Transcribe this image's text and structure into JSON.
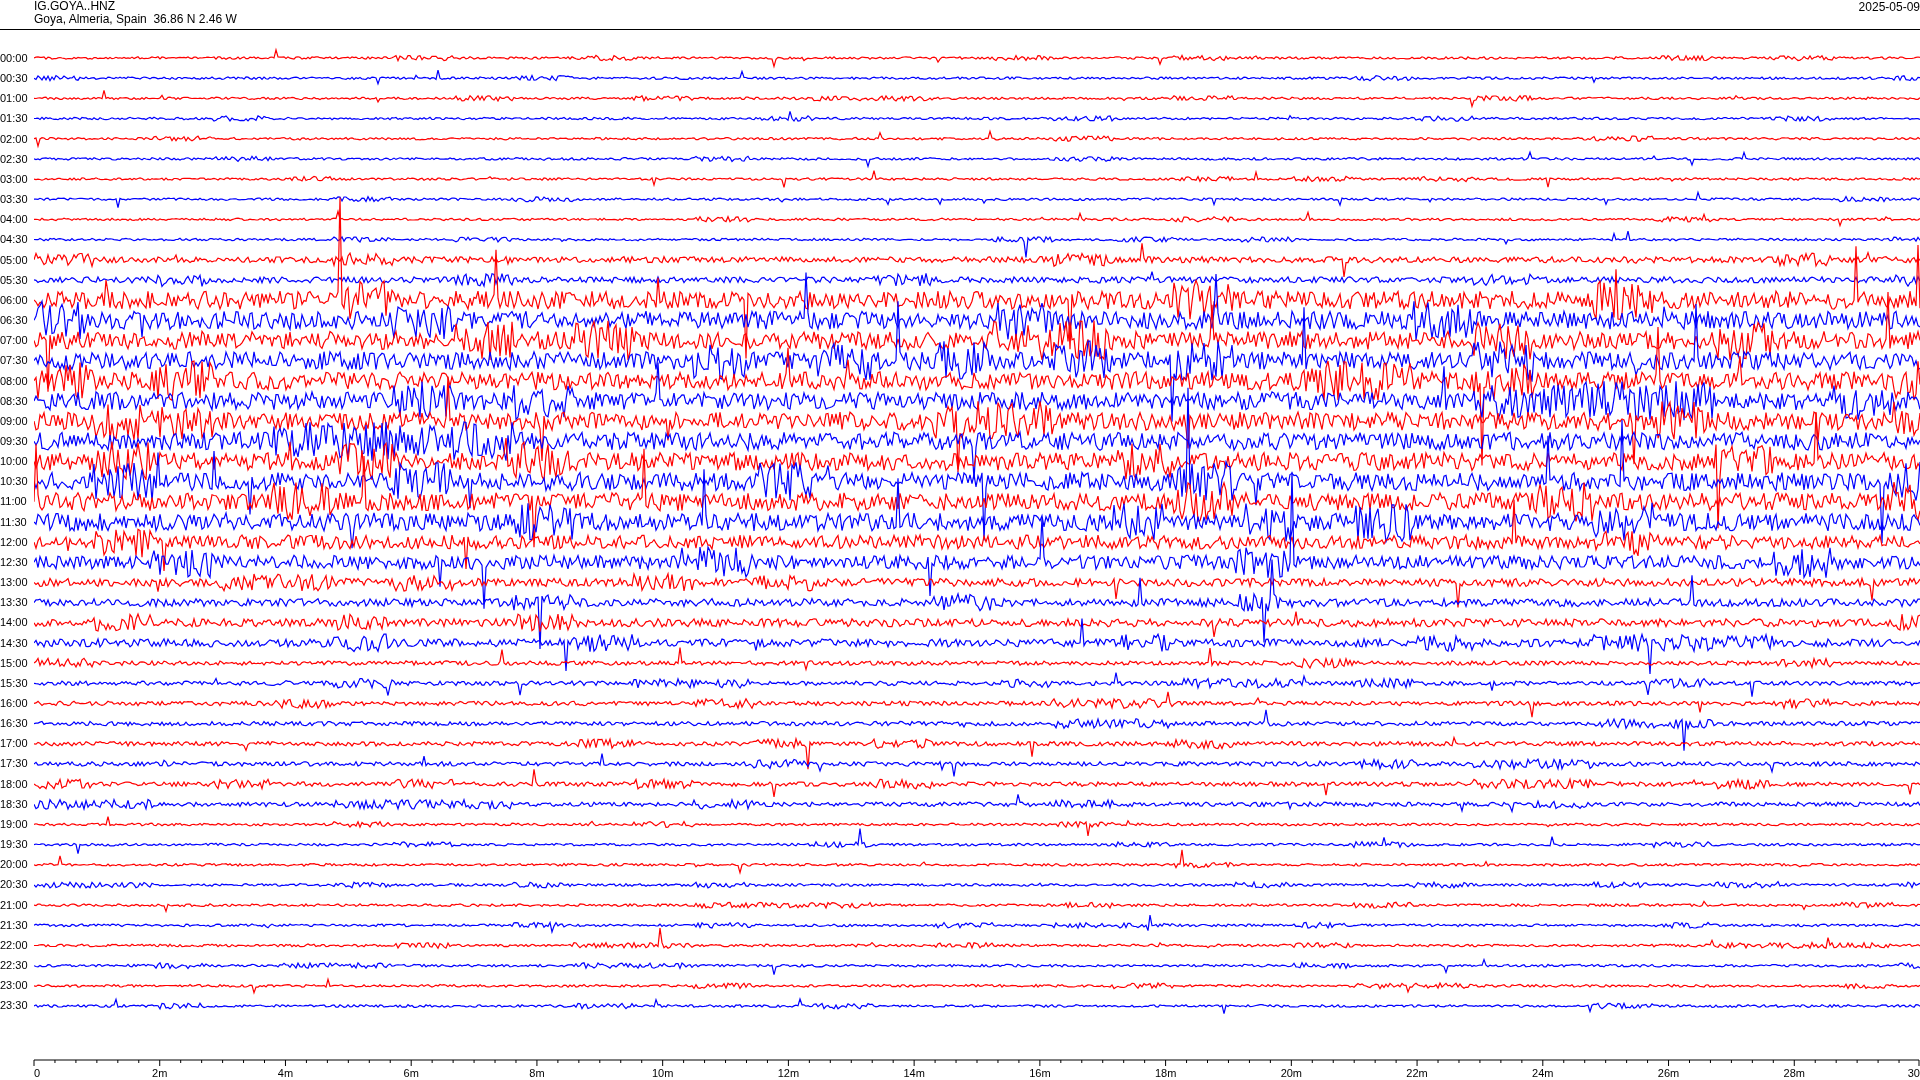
{
  "header": {
    "station": "IG.GOYA..HNZ",
    "location": "Goya, Almeria, Spain  36.86 N 2.46 W",
    "date": "2025-05-09"
  },
  "rows": [
    {
      "label": "00:00",
      "color": "#ff0000"
    },
    {
      "label": "00:30",
      "color": "#0000ff"
    },
    {
      "label": "01:00",
      "color": "#ff0000"
    },
    {
      "label": "01:30",
      "color": "#0000ff"
    },
    {
      "label": "02:00",
      "color": "#ff0000"
    },
    {
      "label": "02:30",
      "color": "#0000ff"
    },
    {
      "label": "03:00",
      "color": "#ff0000"
    },
    {
      "label": "03:30",
      "color": "#0000ff"
    },
    {
      "label": "04:00",
      "color": "#ff0000"
    },
    {
      "label": "04:30",
      "color": "#0000ff"
    },
    {
      "label": "05:00",
      "color": "#ff0000"
    },
    {
      "label": "05:30",
      "color": "#0000ff"
    },
    {
      "label": "06:00",
      "color": "#ff0000"
    },
    {
      "label": "06:30",
      "color": "#0000ff"
    },
    {
      "label": "07:00",
      "color": "#ff0000"
    },
    {
      "label": "07:30",
      "color": "#0000ff"
    },
    {
      "label": "08:00",
      "color": "#ff0000"
    },
    {
      "label": "08:30",
      "color": "#0000ff"
    },
    {
      "label": "09:00",
      "color": "#ff0000"
    },
    {
      "label": "09:30",
      "color": "#0000ff"
    },
    {
      "label": "10:00",
      "color": "#ff0000"
    },
    {
      "label": "10:30",
      "color": "#0000ff"
    },
    {
      "label": "11:00",
      "color": "#ff0000"
    },
    {
      "label": "11:30",
      "color": "#0000ff"
    },
    {
      "label": "12:00",
      "color": "#ff0000"
    },
    {
      "label": "12:30",
      "color": "#0000ff"
    },
    {
      "label": "13:00",
      "color": "#ff0000"
    },
    {
      "label": "13:30",
      "color": "#0000ff"
    },
    {
      "label": "14:00",
      "color": "#ff0000"
    },
    {
      "label": "14:30",
      "color": "#0000ff"
    },
    {
      "label": "15:00",
      "color": "#ff0000"
    },
    {
      "label": "15:30",
      "color": "#0000ff"
    },
    {
      "label": "16:00",
      "color": "#ff0000"
    },
    {
      "label": "16:30",
      "color": "#0000ff"
    },
    {
      "label": "17:00",
      "color": "#ff0000"
    },
    {
      "label": "17:30",
      "color": "#0000ff"
    },
    {
      "label": "18:00",
      "color": "#ff0000"
    },
    {
      "label": "18:30",
      "color": "#0000ff"
    },
    {
      "label": "19:00",
      "color": "#ff0000"
    },
    {
      "label": "19:30",
      "color": "#0000ff"
    },
    {
      "label": "20:00",
      "color": "#ff0000"
    },
    {
      "label": "20:30",
      "color": "#0000ff"
    },
    {
      "label": "21:00",
      "color": "#ff0000"
    },
    {
      "label": "21:30",
      "color": "#0000ff"
    },
    {
      "label": "22:00",
      "color": "#ff0000"
    },
    {
      "label": "22:30",
      "color": "#0000ff"
    },
    {
      "label": "23:00",
      "color": "#ff0000"
    },
    {
      "label": "23:30",
      "color": "#0000ff"
    }
  ],
  "x_axis": {
    "ticks": [
      "0",
      "2m",
      "4m",
      "6m",
      "8m",
      "10m",
      "12m",
      "14m",
      "16m",
      "18m",
      "20m",
      "22m",
      "24m",
      "26m",
      "28m",
      "30"
    ]
  }
}
